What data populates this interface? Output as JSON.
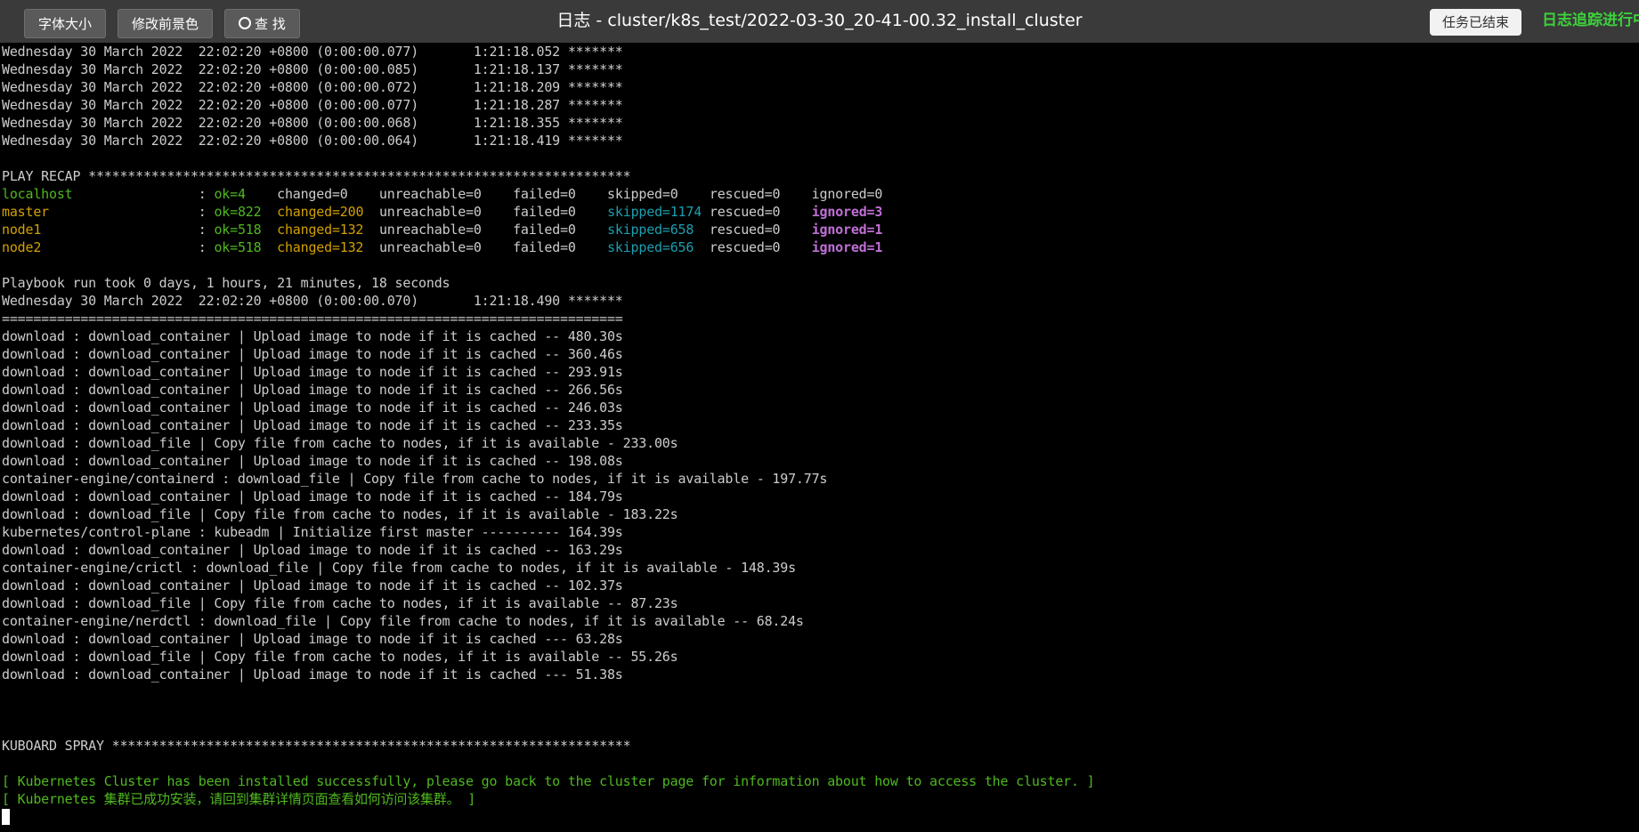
{
  "toolbar": {
    "font_size_label": "字体大小",
    "fg_color_label": "修改前景色",
    "search_label": "查 找",
    "title": "日志 - cluster/k8s_test/2022-03-30_20-41-00.32_install_cluster",
    "task_status_label": "任务已结束",
    "follow_label": "日志追踪进行中"
  },
  "colors": {
    "background": "#000000",
    "toolbar": "#3a3a3a",
    "text": "#cccccc",
    "green": "#4fb81f",
    "yellow": "#d2a000",
    "teal": "#1c9fb0",
    "purple": "#c06fd6"
  },
  "terminal": {
    "timing_lines": [
      "Wednesday 30 March 2022  22:02:20 +0800 (0:00:00.077)       1:21:18.052 *******",
      "Wednesday 30 March 2022  22:02:20 +0800 (0:00:00.085)       1:21:18.137 *******",
      "Wednesday 30 March 2022  22:02:20 +0800 (0:00:00.072)       1:21:18.209 *******",
      "Wednesday 30 March 2022  22:02:20 +0800 (0:00:00.077)       1:21:18.287 *******",
      "Wednesday 30 March 2022  22:02:20 +0800 (0:00:00.068)       1:21:18.355 *******",
      "Wednesday 30 March 2022  22:02:20 +0800 (0:00:00.064)       1:21:18.419 *******"
    ],
    "play_recap_header": "PLAY RECAP *********************************************************************",
    "recap": [
      {
        "host": "localhost",
        "ok": "ok=4",
        "changed": "changed=0",
        "unreachable": "unreachable=0",
        "failed": "failed=0",
        "skipped": "skipped=0",
        "rescued": "rescued=0",
        "ignored": "ignored=0"
      },
      {
        "host": "master",
        "ok": "ok=822",
        "changed": "changed=200",
        "unreachable": "unreachable=0",
        "failed": "failed=0",
        "skipped": "skipped=1174",
        "rescued": "rescued=0",
        "ignored": "ignored=3"
      },
      {
        "host": "node1",
        "ok": "ok=518",
        "changed": "changed=132",
        "unreachable": "unreachable=0",
        "failed": "failed=0",
        "skipped": "skipped=658",
        "rescued": "rescued=0",
        "ignored": "ignored=1"
      },
      {
        "host": "node2",
        "ok": "ok=518",
        "changed": "changed=132",
        "unreachable": "unreachable=0",
        "failed": "failed=0",
        "skipped": "skipped=656",
        "rescued": "rescued=0",
        "ignored": "ignored=1"
      }
    ],
    "playbook_took": "Playbook run took 0 days, 1 hours, 21 minutes, 18 seconds",
    "final_timing": "Wednesday 30 March 2022  22:02:20 +0800 (0:00:00.070)       1:21:18.490 *******",
    "separator": "===============================================================================",
    "task_times": [
      "download : download_container | Upload image to node if it is cached -- 480.30s",
      "download : download_container | Upload image to node if it is cached -- 360.46s",
      "download : download_container | Upload image to node if it is cached -- 293.91s",
      "download : download_container | Upload image to node if it is cached -- 266.56s",
      "download : download_container | Upload image to node if it is cached -- 246.03s",
      "download : download_container | Upload image to node if it is cached -- 233.35s",
      "download : download_file | Copy file from cache to nodes, if it is available - 233.00s",
      "download : download_container | Upload image to node if it is cached -- 198.08s",
      "container-engine/containerd : download_file | Copy file from cache to nodes, if it is available - 197.77s",
      "download : download_container | Upload image to node if it is cached -- 184.79s",
      "download : download_file | Copy file from cache to nodes, if it is available - 183.22s",
      "kubernetes/control-plane : kubeadm | Initialize first master ---------- 164.39s",
      "download : download_container | Upload image to node if it is cached -- 163.29s",
      "container-engine/crictl : download_file | Copy file from cache to nodes, if it is available - 148.39s",
      "download : download_container | Upload image to node if it is cached -- 102.37s",
      "download : download_file | Copy file from cache to nodes, if it is available -- 87.23s",
      "container-engine/nerdctl : download_file | Copy file from cache to nodes, if it is available -- 68.24s",
      "download : download_container | Upload image to node if it is cached --- 63.28s",
      "download : download_file | Copy file from cache to nodes, if it is available -- 55.26s",
      "download : download_container | Upload image to node if it is cached --- 51.38s"
    ],
    "kuboard_header": "KUBOARD SPRAY ******************************************************************",
    "success_en": "[ Kubernetes Cluster has been installed successfully, please go back to the cluster page for information about how to access the cluster. ]",
    "success_zh": "[ Kubernetes 集群已成功安装，请回到集群详情页面查看如何访问该集群。 ]"
  }
}
